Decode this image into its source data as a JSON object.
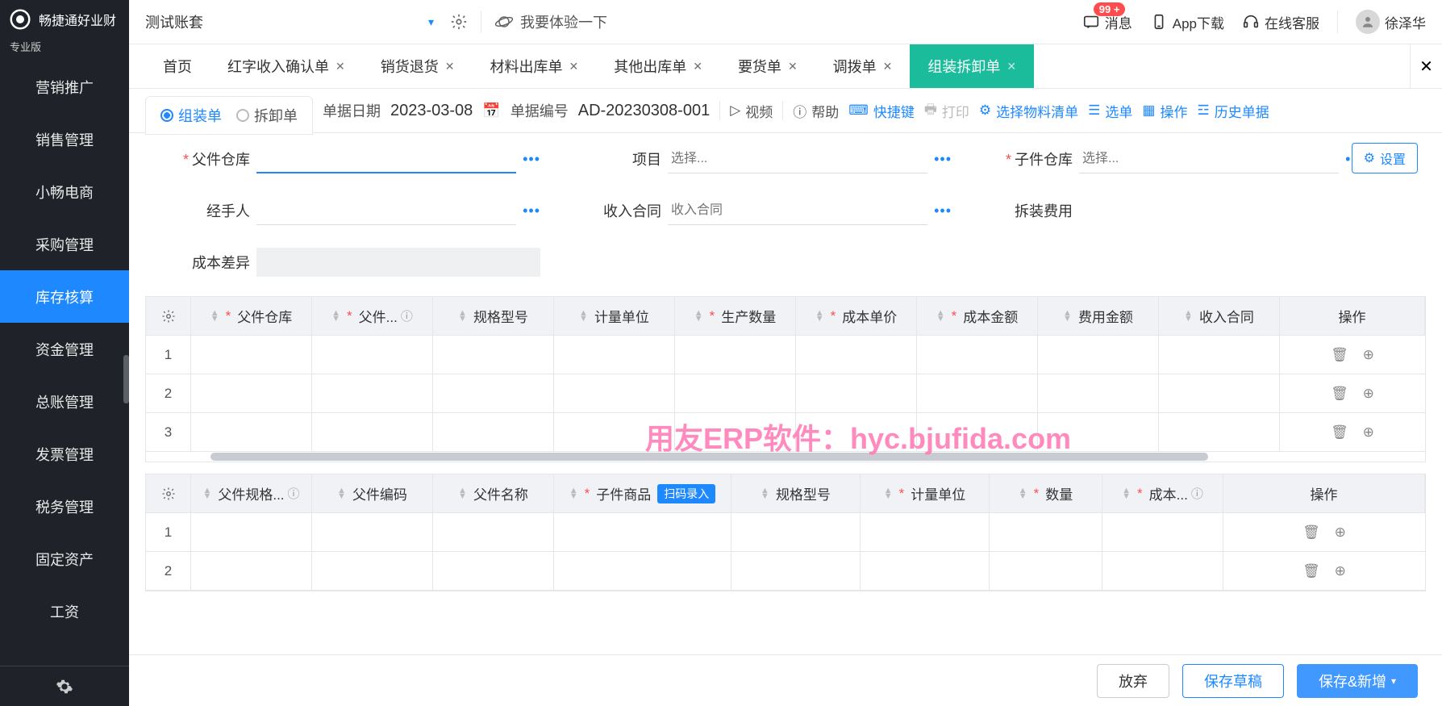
{
  "app": {
    "name": "畅捷通好业财",
    "edition": "专业版"
  },
  "sidebar": {
    "items": [
      "营销推广",
      "销售管理",
      "小畅电商",
      "采购管理",
      "库存核算",
      "资金管理",
      "总账管理",
      "发票管理",
      "税务管理",
      "固定资产",
      "工资"
    ],
    "activeIndex": 4
  },
  "topbar": {
    "account": "测试账套",
    "tryText": "我要体验一下",
    "messages": {
      "label": "消息",
      "badge": "99 +"
    },
    "download": "App下载",
    "service": "在线客服",
    "user": "徐泽华"
  },
  "tabs": {
    "items": [
      {
        "label": "首页",
        "closable": false
      },
      {
        "label": "红字收入确认单",
        "closable": true
      },
      {
        "label": "销货退货",
        "closable": true
      },
      {
        "label": "材料出库单",
        "closable": true
      },
      {
        "label": "其他出库单",
        "closable": true
      },
      {
        "label": "要货单",
        "closable": true
      },
      {
        "label": "调拨单",
        "closable": true
      },
      {
        "label": "组装拆卸单",
        "closable": true,
        "active": true
      }
    ]
  },
  "toolbar": {
    "radio": {
      "opt1": "组装单",
      "opt2": "拆卸单"
    },
    "dateLabel": "单据日期",
    "date": "2023-03-08",
    "codeLabel": "单据编号",
    "code": "AD-20230308-001",
    "video": "视频",
    "help": "帮助",
    "shortcut": "快捷键",
    "print": "打印",
    "bom": "选择物料清单",
    "select": "选单",
    "operate": "操作",
    "history": "历史单据"
  },
  "form": {
    "parentWarehouse": "父件仓库",
    "project": "项目",
    "projectPlaceholder": "选择...",
    "childWarehouse": "子件仓库",
    "childPlaceholder": "选择...",
    "settings": "设置",
    "handler": "经手人",
    "income": "收入合同",
    "incomePlaceholder": "收入合同",
    "cost": "拆装费用",
    "diff": "成本差异"
  },
  "table1": {
    "headers": [
      "*父件仓库",
      "*父件...",
      "规格型号",
      "计量单位",
      "*生产数量",
      "*成本单价",
      "*成本金额",
      "费用金额",
      "收入合同"
    ],
    "opLabel": "操作",
    "rows": [
      1,
      2,
      3
    ]
  },
  "table2": {
    "headers": [
      "父件规格...",
      "父件编码",
      "父件名称",
      "*子件商品",
      "规格型号",
      "*计量单位",
      "*数量",
      "*成本..."
    ],
    "scanTag": "扫码录入",
    "opLabel": "操作",
    "rows": [
      1,
      2
    ]
  },
  "footer": {
    "discard": "放弃",
    "draft": "保存草稿",
    "save": "保存&新增"
  },
  "watermark": "用友ERP软件：hyc.bjufida.com"
}
